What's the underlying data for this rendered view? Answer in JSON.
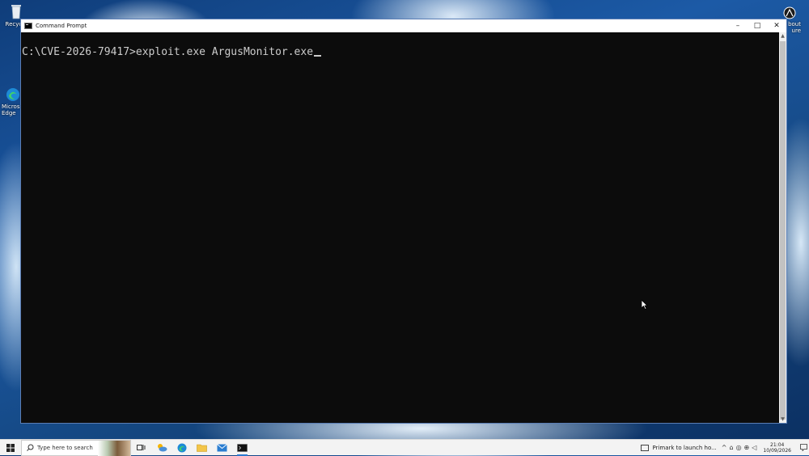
{
  "desktop": {
    "icons": [
      {
        "label": "Recycle"
      },
      {
        "label": "Micros Edge"
      },
      {
        "label": "bout ure"
      }
    ]
  },
  "window": {
    "title": "Command Prompt",
    "controls": {
      "minimize": "–",
      "maximize": "□",
      "close": "✕"
    }
  },
  "console": {
    "prompt": "C:\\CVE-2026-79417>",
    "command": "exploit.exe ArgusMonitor.exe"
  },
  "taskbar": {
    "search_placeholder": "Type here to search",
    "notification_text": "Primark to launch ho...",
    "clock_time": "21:04",
    "clock_date": "10/09/2026",
    "apps": [
      "task-view-icon",
      "weather-icon",
      "edge-icon",
      "file-explorer-icon",
      "mail-icon",
      "command-prompt-icon"
    ]
  },
  "colors": {
    "console_bg": "#0c0c0c",
    "console_text": "#cccccc",
    "taskbar_bg": "#f3f3f3"
  }
}
